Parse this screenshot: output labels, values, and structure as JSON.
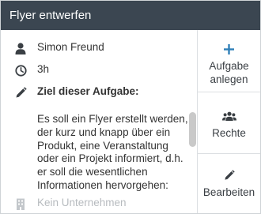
{
  "header": {
    "title": "Flyer entwerfen"
  },
  "details": {
    "assignee": "Simon Freund",
    "duration": "3h",
    "goal_heading": "Ziel dieser Aufgabe:",
    "goal_text": "Es soll ein Flyer erstellt werden, der kurz und knapp über ein Produkt, eine Veranstaltung oder ein Projekt informiert, d.h. er soll die wesentlichen Informationen hervorgehen:",
    "company": "Kein Unternehmen"
  },
  "actions": [
    {
      "label_1": "Aufgabe",
      "label_2": "anlegen",
      "icon": "plus-icon"
    },
    {
      "label": "Rechte",
      "icon": "users-icon"
    },
    {
      "label": "Bearbeiten",
      "icon": "pencil-icon"
    }
  ],
  "colors": {
    "header_bg": "#3b4651",
    "accent_blue": "#2f7fb8",
    "icon_dark": "#3a3f44",
    "muted": "#b7bbbf"
  }
}
